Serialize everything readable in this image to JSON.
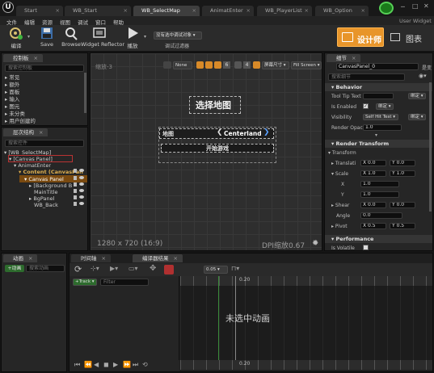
{
  "title_tabs": [
    {
      "label": "Start"
    },
    {
      "label": "WB_Start"
    },
    {
      "label": "WB_SelectMap"
    },
    {
      "label": "AnimatEnter"
    },
    {
      "label": "WB_PlayerList"
    },
    {
      "label": "WB_Option"
    }
  ],
  "user": "User Widget",
  "menu": [
    "文件",
    "编辑",
    "资源",
    "视图",
    "调试",
    "窗口",
    "帮助"
  ],
  "toolbar": {
    "compile": "编译",
    "save": "Save",
    "browse": "Browse",
    "refactor": "Widget Reflector",
    "play": "播放",
    "debug_select": "没有选中调试对象",
    "debug_filter": "调试过滤器",
    "designer": "设计师",
    "graph": "图表"
  },
  "palette": {
    "tab": "控制板",
    "search_placeholder": "搜索控制板",
    "items": [
      "常见",
      "额外",
      "面板",
      "输入",
      "图元",
      "未分类",
      "用户创建的"
    ]
  },
  "hierarchy": {
    "tab": "层次结构",
    "search_placeholder": "搜索控件",
    "items": [
      {
        "label": "[WB_SelectMap]"
      },
      {
        "label": "[Canvas Panel]"
      },
      {
        "label": "AnimatEnter"
      },
      {
        "label": "Content (CanvasPan"
      },
      {
        "label": "Canvas Panel"
      },
      {
        "label": "[Background B"
      },
      {
        "label": "MainTitle"
      },
      {
        "label": "BgPanel"
      },
      {
        "label": "WB_Back"
      }
    ]
  },
  "canvas": {
    "zoom": "缩放-3",
    "size_label": "1280 x 720 (16:9)",
    "dpi": "DPI缩放0.67",
    "none_label": "None",
    "grid_num": "6",
    "snap_num": "4",
    "screen_size": "屏幕尺寸",
    "fill_screen": "Fill Screen",
    "title_text": "选择地图",
    "map_label": "地图",
    "map_name": "Centerland",
    "start_button": "开始游戏"
  },
  "details": {
    "tab": "细节",
    "name": "CanvasPanel_0",
    "is_variable": "是变",
    "search_placeholder": "搜索细节",
    "behavior": "Behavior",
    "tooltip_label": "Tool Tip Text",
    "bind": "绑定",
    "enabled_label": "Is Enabled",
    "visibility_label": "Visibility",
    "visibility_value": "Self Hit Test",
    "opacity_label": "Render Opacit",
    "opacity_value": "1.0",
    "render_transform": "Render Transform",
    "transform": "Transform",
    "translation_label": "Translati",
    "translation_x": "X 0.0",
    "translation_y": "Y 0.0",
    "scale_label": "Scale",
    "scale_x": "X 1.0",
    "scale_y": "Y 1.0",
    "x_label": "X",
    "x_value": "1.0",
    "y_label": "Y",
    "y_value": "1.0",
    "shear_label": "Shear",
    "shear_x": "X 0.0",
    "shear_y": "Y 0.0",
    "angle_label": "Angle",
    "angle_value": "0.0",
    "pivot_label": "Pivot",
    "pivot_x": "X 0.5",
    "pivot_y": "Y 0.5",
    "performance": "Performance",
    "volatile_label": "Is Volatile"
  },
  "animation": {
    "tab": "动画",
    "add": "+动画",
    "search_placeholder": "搜索动画"
  },
  "timeline": {
    "tab1": "时间轴",
    "tab2": "编译器结果",
    "track": "Track",
    "filter_placeholder": "Filter",
    "time_value": "0.05",
    "ruler_top": "0.20",
    "ruler_bottom": "0.20",
    "empty_message": "未选中动画"
  },
  "colors": {
    "accent": "#f09a2a",
    "selection": "#c87a1a",
    "canvas_bg": "#2e2e2e"
  }
}
